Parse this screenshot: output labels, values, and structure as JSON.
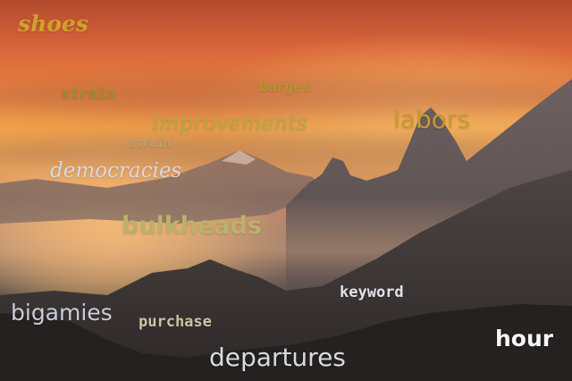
{
  "image": {
    "description_colors": {
      "sky_top": "#b24a2e",
      "sky_mid": "#f0a14a",
      "haze": "#c9896a",
      "mountain_far": "#726364",
      "mountain_mid": "#554a49",
      "mountain_near": "#2e2a29"
    }
  },
  "words": [
    {
      "id": "shoes",
      "text": "shoes",
      "color": "#d1a12d"
    },
    {
      "id": "strain-1",
      "text": "strain",
      "color": "#9a8f2e"
    },
    {
      "id": "barges",
      "text": "barges",
      "color": "#b59533"
    },
    {
      "id": "improvements",
      "text": "improvements",
      "color": "#b6a742"
    },
    {
      "id": "labors",
      "text": "labors",
      "color": "#c59a2e"
    },
    {
      "id": "strain-2",
      "text": "strain",
      "color": "#bea076"
    },
    {
      "id": "democracies",
      "text": "democracies",
      "color": "#d8d7e1"
    },
    {
      "id": "bulkheads",
      "text": "bulkheads",
      "color": "#bbb16b"
    },
    {
      "id": "keyword",
      "text": "keyword",
      "color": "#e2e1ea"
    },
    {
      "id": "bigamies",
      "text": "bigamies",
      "color": "#c8cbd8"
    },
    {
      "id": "purchase",
      "text": "purchase",
      "color": "#c9c3a4"
    },
    {
      "id": "departures",
      "text": "departures",
      "color": "#d9dadf"
    },
    {
      "id": "hour",
      "text": "hour",
      "color": "#f7f7f7"
    }
  ]
}
